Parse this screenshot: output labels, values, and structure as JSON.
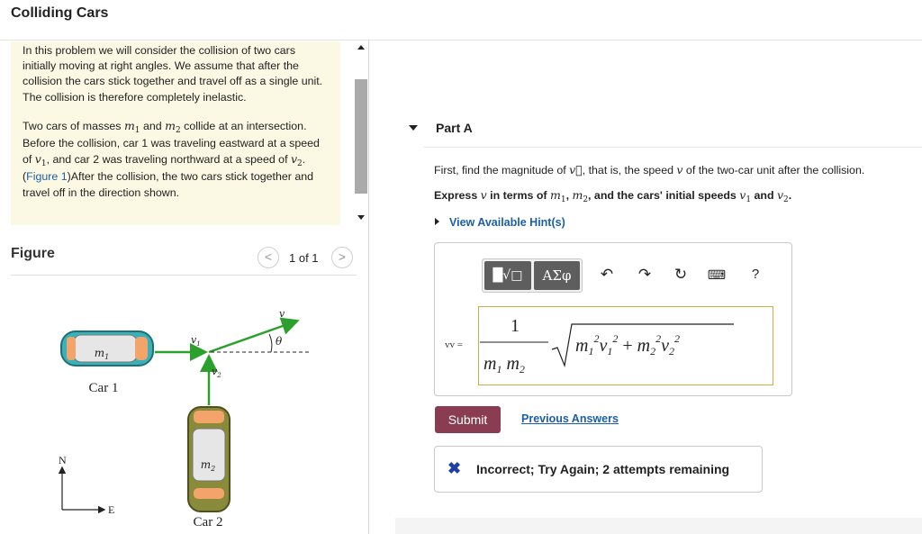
{
  "header": {
    "title": "Colliding Cars"
  },
  "intro": {
    "p1": "In this problem we will consider the collision of two cars initially moving at right angles. We assume that after the collision the cars stick together and travel off as a single unit. The collision is therefore completely inelastic.",
    "p2_a": "Two cars of masses ",
    "m1": "m",
    "sub1": "1",
    "p2_and": " and ",
    "m2": "m",
    "sub2": "2",
    "p2_b": " collide at an intersection. Before the collision, car 1 was traveling eastward at a speed of ",
    "v": "v",
    "p2_c": ", and car 2 was traveling northward at a speed of ",
    "p2_d": ". (",
    "figure_link": "Figure 1",
    "p2_e": ")After the collision, the two cars stick together and travel off in the direction shown."
  },
  "figure": {
    "label": "Figure",
    "counter": "1 of 1",
    "prev_icon": "chevron-left-icon",
    "next_icon": "chevron-right-icon",
    "prev_glyph": "<",
    "next_glyph": ">",
    "car1_label": "Car 1",
    "car2_label": "Car 2",
    "m1_label": "m",
    "m1_sub": "1",
    "m2_label": "m",
    "m2_sub": "2",
    "v_label": "v",
    "v1_label": "v",
    "v1_sub": "1",
    "v2_label": "v",
    "v2_sub": "2",
    "theta_label": "θ",
    "compass_n": "N",
    "compass_e": "E",
    "car1_color": "#3ab0b8",
    "car2_color": "#8a8b3a",
    "vector_color": "#2ca02c"
  },
  "part": {
    "title": "Part A",
    "question_a": "First, find the magnitude of ",
    "question_b": ", that is, the speed ",
    "question_c": " of the two-car unit after the collision.",
    "express_a": "Express ",
    "express_b": " in terms of ",
    "express_c": ", and the cars' initial speeds ",
    "express_d": " and ",
    "express_e": ".",
    "comma": ", ",
    "hint_label": "View Available Hint(s)"
  },
  "toolbar": {
    "templates_label": "█√□",
    "symbols_label": "ΑΣφ",
    "undo_glyph": "↶",
    "redo_glyph": "↷",
    "reset_glyph": "↻",
    "keyboard_glyph": "⌨",
    "help_label": "?"
  },
  "answer": {
    "variable_label": "vv =",
    "numerator": "1",
    "den_m1": "m",
    "den_1": "1",
    "den_m2": "m",
    "den_2": "2",
    "rad_m": "m",
    "rad_v": "v",
    "sub_1": "1",
    "sub_2": "2",
    "sup_2": "2",
    "plus": "+"
  },
  "actions": {
    "submit_label": "Submit",
    "previous_answers_label": "Previous Answers"
  },
  "feedback": {
    "icon": "✖",
    "text": "Incorrect; Try Again; 2 attempts remaining"
  },
  "colors": {
    "accent_link": "#1b5fa8",
    "submit_bg": "#8a3d52",
    "intro_bg": "#fbf8e3",
    "incorrect_icon": "#1f3fa6"
  }
}
